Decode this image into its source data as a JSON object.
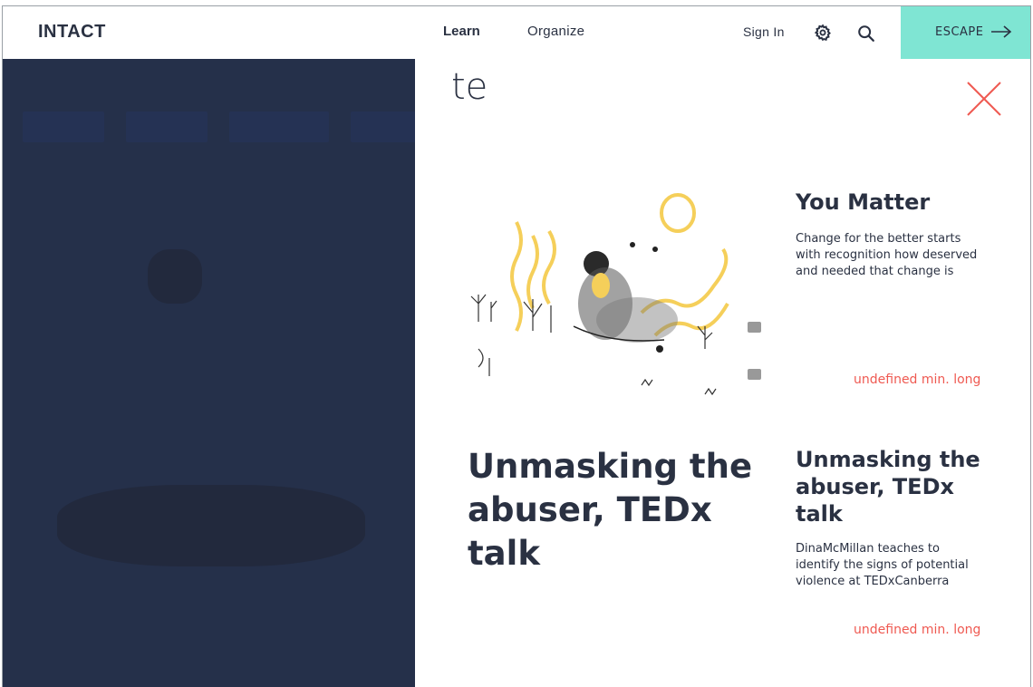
{
  "header": {
    "logo": "INTACT",
    "nav": {
      "learn": "Learn",
      "organize": "Organize"
    },
    "sign_in": "Sign In",
    "escape_label": "ESCAPE",
    "icons": {
      "settings": "gear-icon",
      "search": "search-icon",
      "escape": "arrow-right-icon"
    },
    "escape_color": "#7fe5d3"
  },
  "search_panel": {
    "query": "te",
    "close_icon": "close-icon",
    "accent": "#ef5a52",
    "results": [
      {
        "title": "You Matter",
        "description": "Change for the better starts with recognition how deserved and needed that change is",
        "duration": "undefined min. long",
        "image": "illustration"
      },
      {
        "thumb_title": "Unmasking the abuser, TEDx talk",
        "title": "Unmasking the abuser, TEDx talk",
        "description": "DinaMcMillan teaches to identify the signs of potential violence at TEDxCanberra",
        "duration": "undefined min. long"
      }
    ]
  },
  "colors": {
    "overlay": "#25304a",
    "text": "#2a3142"
  }
}
